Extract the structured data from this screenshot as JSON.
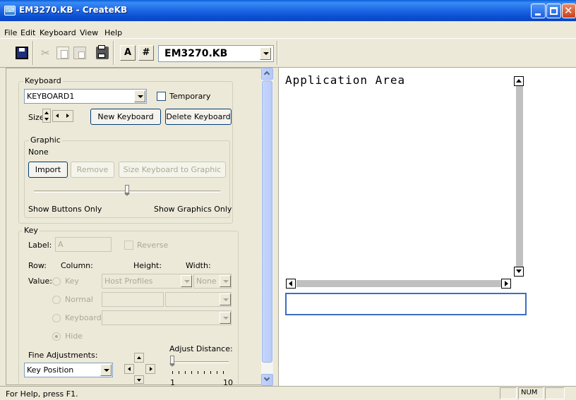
{
  "window": {
    "title": "EM3270.KB - CreateKB",
    "icon": "keyboard-app-icon"
  },
  "menu": {
    "items": [
      {
        "label": "File",
        "mnemonic": "F"
      },
      {
        "label": "Edit",
        "mnemonic": "E"
      },
      {
        "label": "Keyboard",
        "mnemonic": "K"
      },
      {
        "label": "View",
        "mnemonic": "V"
      },
      {
        "label": "Help",
        "mnemonic": "H"
      }
    ]
  },
  "toolbar": {
    "icons": [
      "save-icon",
      "cut-icon",
      "copy-icon",
      "paste-icon",
      "print-icon"
    ],
    "a_label": "A",
    "hash_label": "#",
    "keyboard_combo_value": "EM3270.KB"
  },
  "keyboard_group": {
    "label": "Keyboard",
    "selected_keyboard": "KEYBOARD1",
    "temporary_label": "Temporary",
    "size_label": "Size:",
    "new_keyboard_label": "New Keyboard",
    "delete_keyboard_label": "Delete Keyboard"
  },
  "graphic_group": {
    "label": "Graphic",
    "value": "None",
    "import_label": "Import",
    "remove_label": "Remove",
    "size_to_graphic_label": "Size Keyboard to Graphic",
    "slider_left_label": "Show Buttons Only",
    "slider_right_label": "Show Graphics Only",
    "slider_level": 0.5
  },
  "key_group": {
    "label": "Key",
    "label_field_label": "Label:",
    "label_field_value": "A",
    "reverse_label": "Reverse",
    "row_label": "Row:",
    "column_label": "Column:",
    "height_label": "Height:",
    "width_label": "Width:",
    "value_label": "Value:",
    "radio_key_label": "Key",
    "radio_normal_label": "Normal",
    "radio_keyboard_label": "Keyboard",
    "radio_hide_label": "Hide",
    "host_profiles_value": "Host Profiles",
    "none_value": "None",
    "fine_adjustments_label": "Fine Adjustments:",
    "fine_adjustments_value": "Key Position",
    "adjust_distance_label": "Adjust Distance:",
    "adjust_min": "1",
    "adjust_max": "10",
    "adjust_level": 1
  },
  "app_area": {
    "title": "Application Area"
  },
  "status": {
    "help_text": "For Help, press F1.",
    "num_indicator": "NUM"
  }
}
